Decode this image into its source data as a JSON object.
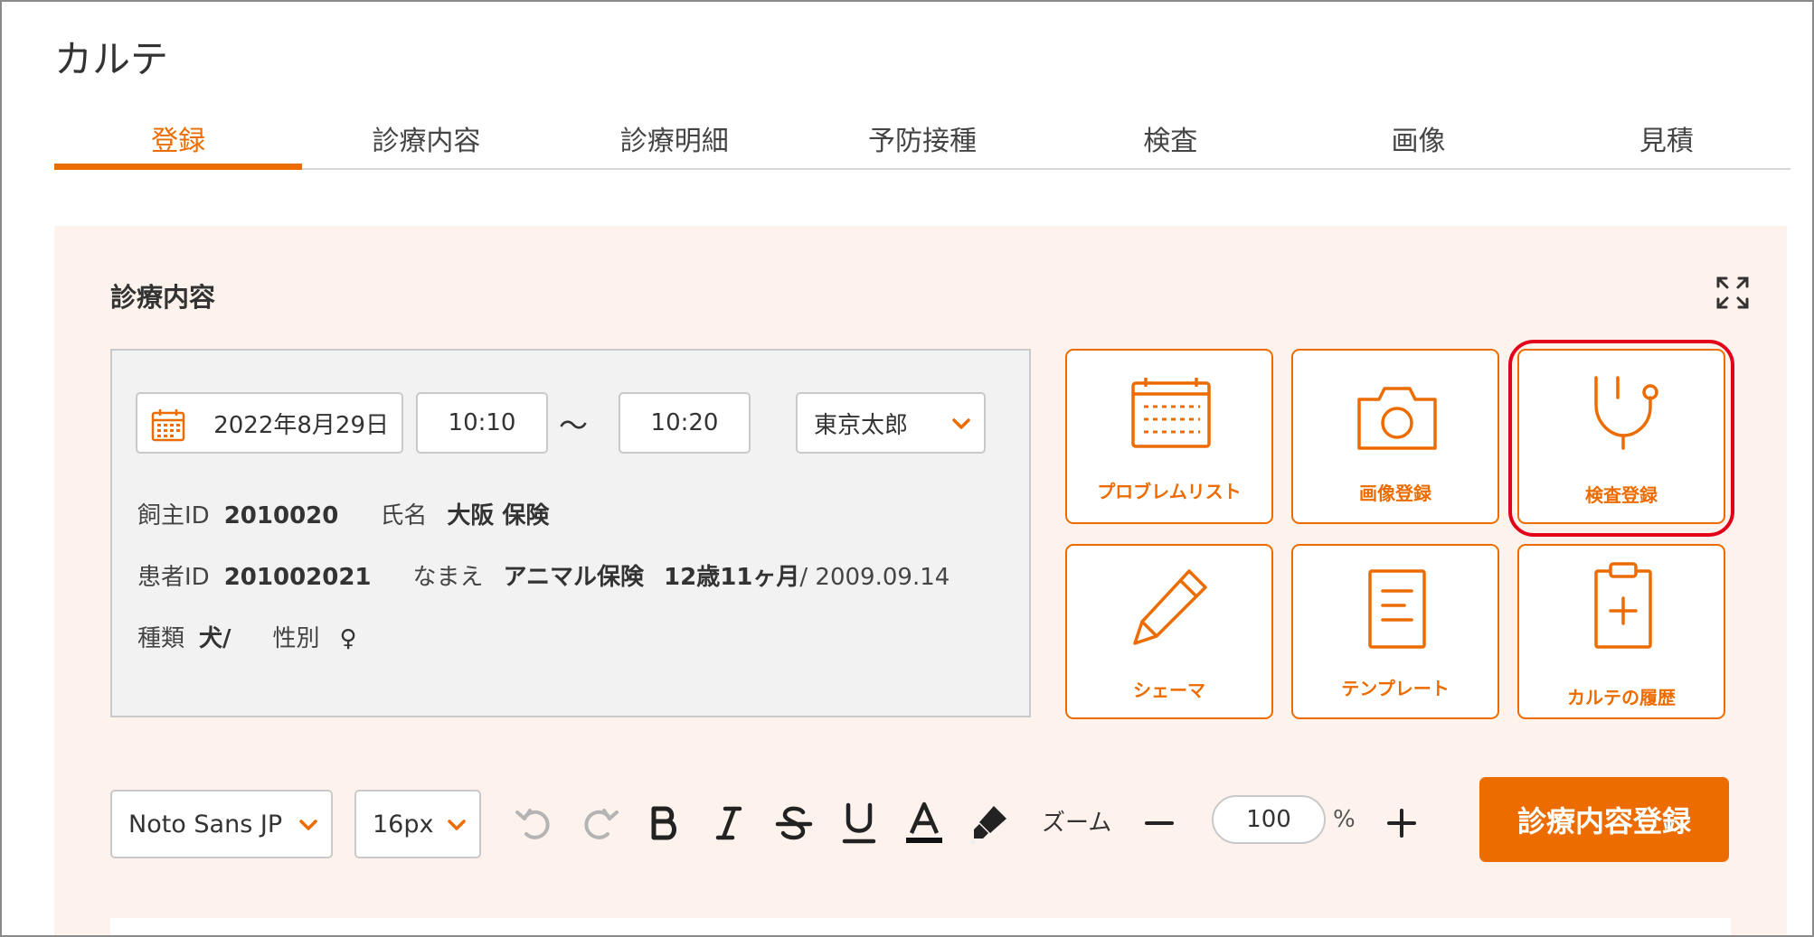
{
  "page": {
    "title": "カルテ"
  },
  "tabs": [
    {
      "label": "登録",
      "active": true
    },
    {
      "label": "診療内容"
    },
    {
      "label": "診療明細"
    },
    {
      "label": "予防接種"
    },
    {
      "label": "検査"
    },
    {
      "label": "画像"
    },
    {
      "label": "見積"
    }
  ],
  "section": {
    "title": "診療内容"
  },
  "visit": {
    "date": "2022年8月29日",
    "start_time": "10:10",
    "separator": "〜",
    "end_time": "10:20",
    "doctor": "東京太郎"
  },
  "patient": {
    "owner_id_label": "飼主ID",
    "owner_id": "2010020",
    "name_label": "氏名",
    "name": "大阪 保険",
    "patient_id_label": "患者ID",
    "patient_id": "201002021",
    "pet_name_label": "なまえ",
    "pet_name": "アニマル保険",
    "age": "12歳11ヶ月",
    "birth": "/ 2009.09.14",
    "species_label": "種類",
    "species": "犬/",
    "sex_label": "性別",
    "sex": "♀"
  },
  "tiles": [
    {
      "label": "プロブレムリスト",
      "icon": "calendar-grid-icon"
    },
    {
      "label": "画像登録",
      "icon": "camera-icon"
    },
    {
      "label": "検査登録",
      "icon": "stethoscope-icon",
      "highlighted": true
    },
    {
      "label": "シェーマ",
      "icon": "pencil-icon"
    },
    {
      "label": "テンプレート",
      "icon": "document-icon"
    },
    {
      "label": "カルテの履歴",
      "icon": "clipboard-plus-icon"
    }
  ],
  "toolbar": {
    "font_family": "Noto Sans JP",
    "font_size": "16px",
    "zoom_label": "ズーム",
    "zoom_value": "100",
    "zoom_unit": "%",
    "submit_label": "診療内容登録"
  },
  "colors": {
    "accent": "#ec6c00",
    "panel_bg": "#fdf3ec",
    "highlight": "#e3001b",
    "disabled_icon": "#b4b4b4"
  }
}
